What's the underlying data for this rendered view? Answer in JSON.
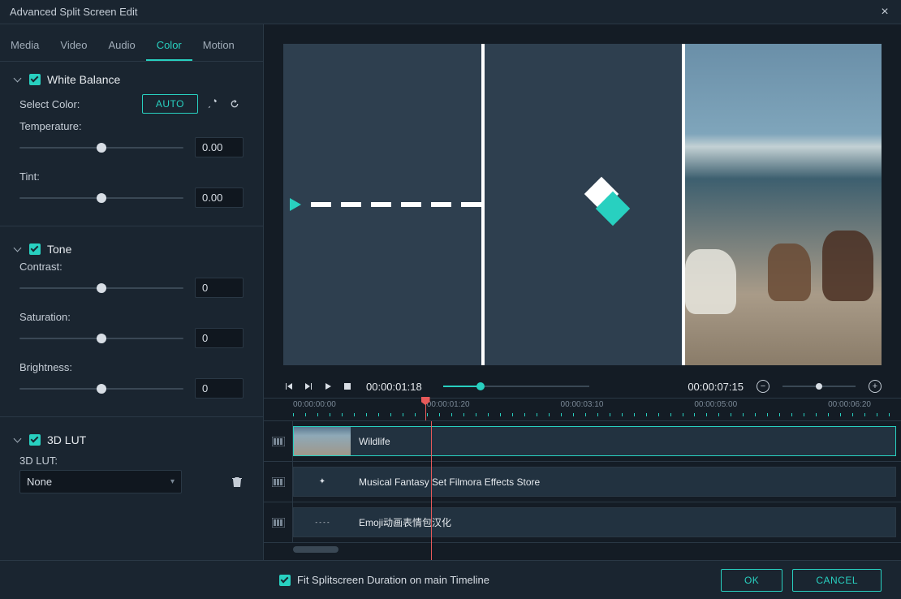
{
  "window": {
    "title": "Advanced Split Screen Edit"
  },
  "tabs": {
    "media": "Media",
    "video": "Video",
    "audio": "Audio",
    "color": "Color",
    "motion": "Motion"
  },
  "whiteBalance": {
    "title": "White Balance",
    "selectColorLabel": "Select Color:",
    "autoBtn": "AUTO",
    "temperatureLabel": "Temperature:",
    "temperatureValue": "0.00",
    "tintLabel": "Tint:",
    "tintValue": "0.00"
  },
  "tone": {
    "title": "Tone",
    "contrastLabel": "Contrast:",
    "contrastValue": "0",
    "saturationLabel": "Saturation:",
    "saturationValue": "0",
    "brightnessLabel": "Brightness:",
    "brightnessValue": "0"
  },
  "lut": {
    "title": "3D LUT",
    "label": "3D LUT:",
    "selected": "None"
  },
  "playback": {
    "currentTime": "00:00:01:18",
    "duration": "00:00:07:15"
  },
  "ruler": {
    "marks": [
      "00:00:00:00",
      "00:00:01:20",
      "00:00:03:10",
      "00:00:05:00",
      "00:00:06:20"
    ]
  },
  "tracks": [
    {
      "name": "Wildlife"
    },
    {
      "name": "Musical Fantasy Set Filmora Effects Store"
    },
    {
      "name": "Emoji动画表情包汉化"
    }
  ],
  "footer": {
    "fitLabel": "Fit Splitscreen Duration on main Timeline",
    "okBtn": "OK",
    "cancelBtn": "CANCEL"
  }
}
